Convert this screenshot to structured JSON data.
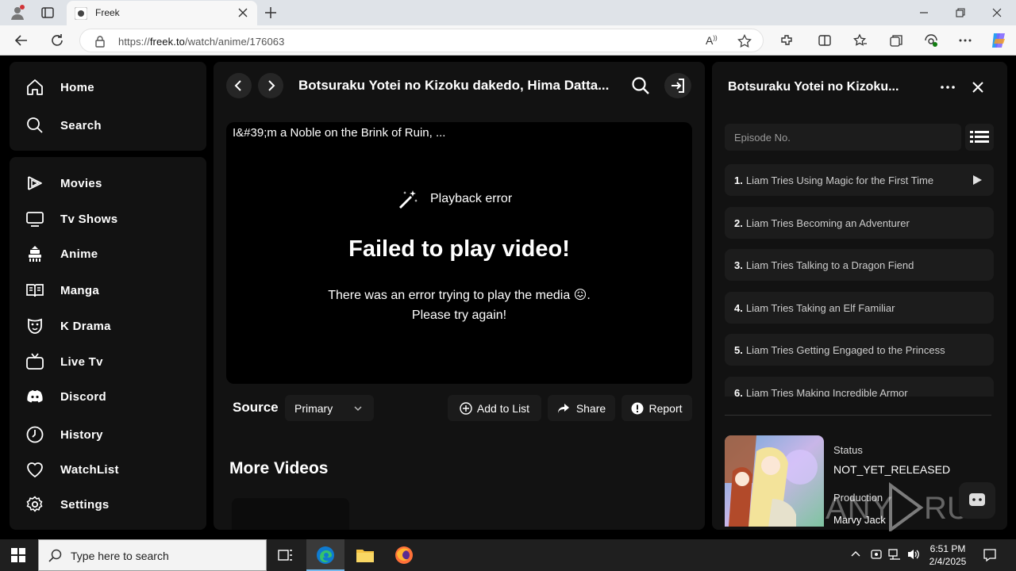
{
  "browser": {
    "tab_title": "Freek",
    "url_prefix": "https://",
    "url_domain": "freek.to",
    "url_path": "/watch/anime/176063"
  },
  "sidebar": {
    "top": [
      {
        "label": "Home",
        "icon": "home-icon"
      },
      {
        "label": "Search",
        "icon": "search-icon"
      }
    ],
    "items": [
      {
        "label": "Movies",
        "icon": "movies-icon"
      },
      {
        "label": "Tv Shows",
        "icon": "tv-icon"
      },
      {
        "label": "Anime",
        "icon": "anime-icon"
      },
      {
        "label": "Manga",
        "icon": "book-icon"
      },
      {
        "label": "K Drama",
        "icon": "mask-icon"
      },
      {
        "label": "Live Tv",
        "icon": "live-tv-icon"
      },
      {
        "label": "Discord",
        "icon": "discord-icon"
      },
      {
        "label": "History",
        "icon": "clock-icon"
      },
      {
        "label": "WatchList",
        "icon": "heart-icon"
      },
      {
        "label": "Settings",
        "icon": "gear-icon"
      }
    ]
  },
  "main": {
    "title": "Botsuraku Yotei no Kizoku dakedo, Hima Datta...",
    "video_caption": "I&#39;m a Noble on the Brink of Ruin, ...",
    "error_label": "Playback error",
    "error_title": "Failed to play video!",
    "error_line1": "There was an error trying to play the media 😖.",
    "error_line2": "Please try again!",
    "source_label": "Source",
    "source_value": "Primary",
    "add_to_list": "Add to List",
    "share": "Share",
    "report": "Report",
    "more_videos": "More Videos"
  },
  "right_panel": {
    "title": "Botsuraku Yotei no Kizoku...",
    "episode_placeholder": "Episode No.",
    "episodes": [
      {
        "num": "1.",
        "title": "Liam Tries Using Magic for the First Time"
      },
      {
        "num": "2.",
        "title": "Liam Tries Becoming an Adventurer"
      },
      {
        "num": "3.",
        "title": "Liam Tries Talking to a Dragon Fiend"
      },
      {
        "num": "4.",
        "title": "Liam Tries Taking an Elf Familiar"
      },
      {
        "num": "5.",
        "title": "Liam Tries Getting Engaged to the Princess"
      },
      {
        "num": "6.",
        "title": "Liam Tries Making Incredible Armor"
      }
    ],
    "status_label": "Status",
    "status_value": "NOT_YET_RELEASED",
    "production_label": "Production",
    "production_value": "Marvy Jack"
  },
  "watermark": "ANY RUN",
  "taskbar": {
    "search_placeholder": "Type here to search",
    "time": "6:51 PM",
    "date": "2/4/2025"
  },
  "colors": {
    "panel": "#121212",
    "accent_edge": "#0078d4"
  }
}
